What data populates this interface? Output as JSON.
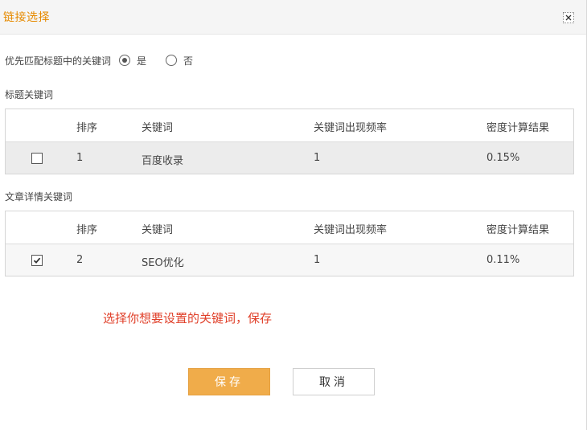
{
  "dialog": {
    "title": "链接选择",
    "close_icon": "close-icon"
  },
  "preference": {
    "label": "优先匹配标题中的关键词",
    "options": [
      {
        "label": "是",
        "checked": true
      },
      {
        "label": "否",
        "checked": false
      }
    ]
  },
  "title_keywords": {
    "section_label": "标题关键词",
    "columns": [
      "排序",
      "关键词",
      "关键词出现频率",
      "密度计算结果"
    ],
    "rows": [
      {
        "checked": false,
        "rank": "1",
        "keyword": "百度收录",
        "frequency": "1",
        "density": "0.15%"
      }
    ]
  },
  "article_keywords": {
    "section_label": "文章详情关键词",
    "columns": [
      "排序",
      "关键词",
      "关键词出现频率",
      "密度计算结果"
    ],
    "rows": [
      {
        "checked": true,
        "rank": "2",
        "keyword": "SEO优化",
        "frequency": "1",
        "density": "0.11%"
      }
    ]
  },
  "hint": "选择你想要设置的关键词，保存",
  "buttons": {
    "save": "保存",
    "cancel": "取消"
  },
  "colors": {
    "title": "#e68a00",
    "hint": "#e0402a",
    "save_button": "#f0ac4a"
  }
}
